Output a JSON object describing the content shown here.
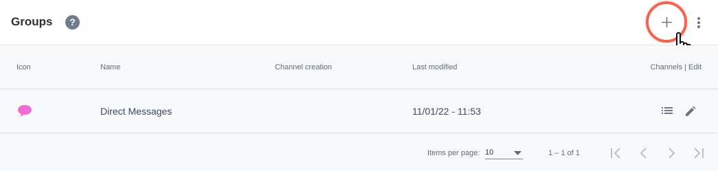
{
  "header": {
    "title": "Groups",
    "help_glyph": "?",
    "add_icon": "plus-icon",
    "cursor_icon": "hand-pointer-icon",
    "menu_icon": "more-vert-icon",
    "highlight_color": "#ec6653"
  },
  "table": {
    "columns": [
      "Icon",
      "Name",
      "Channel creation",
      "Last modified",
      "Channels | Edit"
    ],
    "rows": [
      {
        "icon": "chat-bubble-icon",
        "icon_color": "#ef6cd0",
        "name": "Direct Messages",
        "channel_creation": "",
        "last_modified": "11/01/22 - 11:53",
        "actions": [
          "list-icon",
          "edit-pencil-icon"
        ]
      }
    ]
  },
  "pagination": {
    "items_per_page_label": "Items per page:",
    "items_per_page_value": "10",
    "range": "1 – 1 of 1",
    "nav_icons": [
      "first-page-icon",
      "previous-page-icon",
      "next-page-icon",
      "last-page-icon"
    ]
  }
}
